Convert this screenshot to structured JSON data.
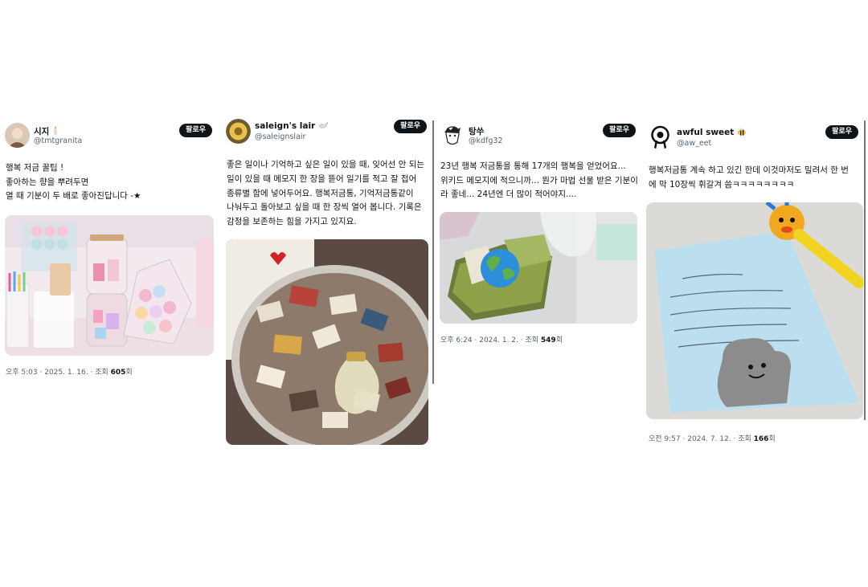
{
  "follow_label": "팔로우",
  "views_label": "조회",
  "views_suffix": "회",
  "posts": [
    {
      "name": "시지",
      "name_emoji": "candle-emoji",
      "handle": "@tmtgranita",
      "lines": [
        "행복 저금 꿀팁 !",
        "좋아하는 향을 뿌려두면",
        "열 때 기분이 두 배로 좋아진답니다 -★"
      ],
      "date": "오후 5:03 · 2025. 1. 16.",
      "views": "605"
    },
    {
      "name": "saleign's lair",
      "name_emoji": "dove-emoji",
      "handle": "@saleignslair",
      "lines": [
        "좋은 일이나 기억하고 싶은 일이 있을 때, 잊어선 안 되는 일이 있을 때 메모지 한 장을 뜯어 일기를 적고 잘 접어 종류별 함에 넣어두어요. 행복저금통, 기억저금통같이 나눠두고 돌아보고 싶을 때 한 장씩 열어 봅니다. 기록은 감정을 보존하는 힘을 가지고 있지요."
      ]
    },
    {
      "name": "탕쑤",
      "handle": "@kdfg32",
      "lines": [
        "23년 행복 저금통을 통해 17개의 행복을 얻었어요...",
        "위키드 메모지에 적으니까... 뭔가 마법 선물 받은 기분이",
        "라 좋네... 24년엔 더 많이 적어야지...."
      ],
      "date": "오후 6:24 · 2024. 1. 2.",
      "views": "549"
    },
    {
      "name": "awful sweet",
      "name_emoji": "bee-emoji",
      "handle": "@aw_eet",
      "lines": [
        "행복저금통 계속 하고 있긴 한데 이것마저도 밀려서 한 번",
        "에 막 10장씩 휘갈겨 씀ㅋㅋㅋㅋㅋㅋㅋㅋ"
      ],
      "date": "오전 9:57 · 2024. 7. 12.",
      "views": "166"
    }
  ]
}
